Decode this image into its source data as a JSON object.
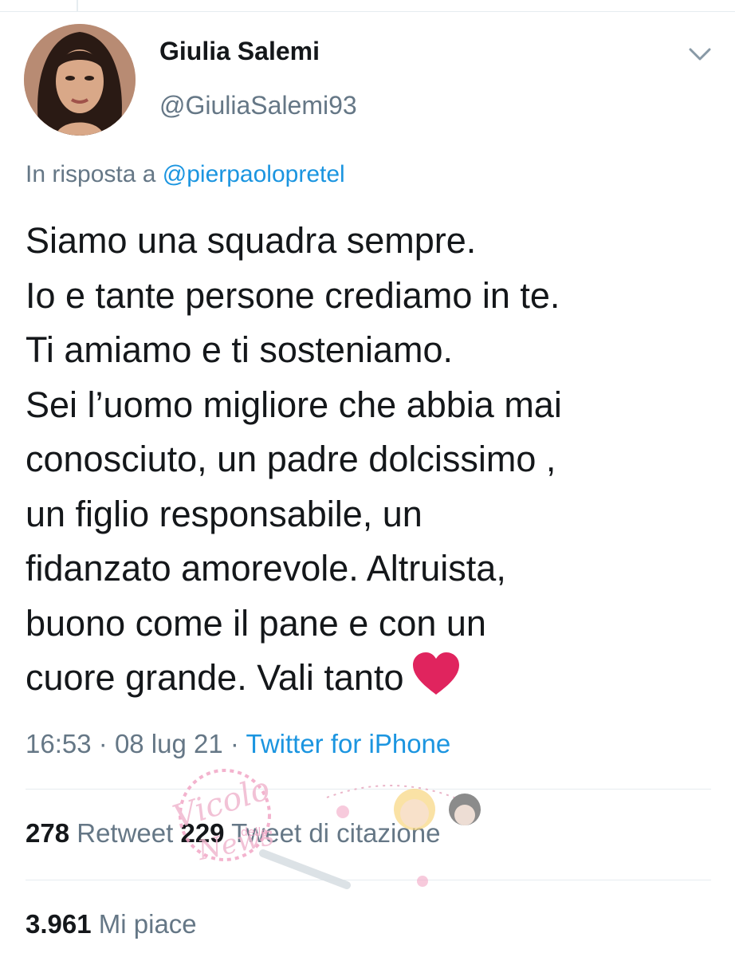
{
  "tweet": {
    "author": {
      "display_name": "Giulia Salemi",
      "handle": "@GiuliaSalemi93",
      "avatar_icon": "profile-photo"
    },
    "reply": {
      "prefix": "In risposta a",
      "mention": "@pierpaolopretel"
    },
    "body_lines": [
      "Siamo una squadra sempre.",
      "Io e tante persone crediamo in te.",
      "Ti amiamo e ti sosteniamo.",
      "Sei l’uomo migliore che abbia mai",
      "conosciuto, un padre dolcissimo ,",
      "un figlio responsabile, un",
      "fidanzato amorevole. Altruista,",
      "buono come il pane e con un",
      "cuore grande. Vali tanto"
    ],
    "emoji": "heart-icon",
    "time": "16:53",
    "date": "08 lug 21",
    "separator": "·",
    "source": "Twitter for iPhone"
  },
  "stats": {
    "retweets_count": "278",
    "retweets_label": "Retweet",
    "quotes_count": "229",
    "quotes_label": "Tweet di citazione",
    "likes_count": "3.961",
    "likes_label": "Mi piace"
  },
  "watermark": {
    "text": "Vicolo delle News"
  },
  "colors": {
    "text_primary": "#14171a",
    "text_secondary": "#657786",
    "link": "#1b95e0",
    "heart": "#e0245e",
    "divider": "#e6ecf0"
  }
}
